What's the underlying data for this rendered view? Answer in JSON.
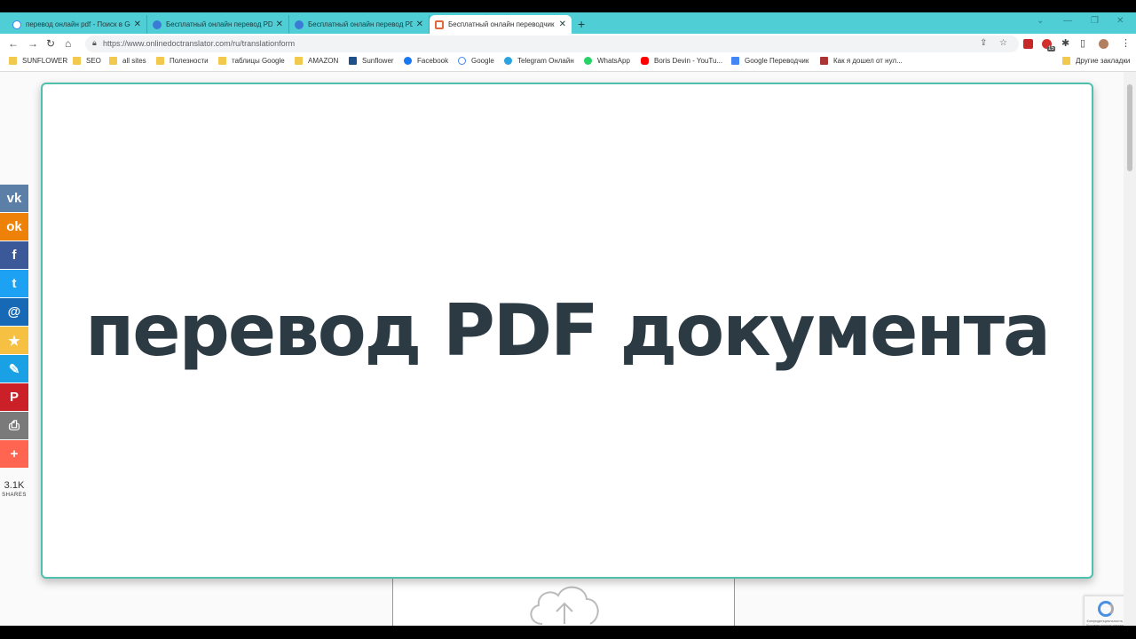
{
  "tabs": [
    {
      "title": "перевод онлайн pdf - Поиск в Google",
      "favicon": "google-icon",
      "active": false
    },
    {
      "title": "Бесплатный онлайн перевод PDF",
      "favicon": "translator-icon",
      "active": false
    },
    {
      "title": "Бесплатный онлайн перевод PDF",
      "favicon": "translator-icon",
      "active": false
    },
    {
      "title": "Бесплатный онлайн переводчик",
      "favicon": "onlinedoctranslator-icon",
      "active": true
    }
  ],
  "new_tab_label": "+",
  "address": {
    "url": "https://www.onlinedoctranslator.com/ru/translationform"
  },
  "bookmarks": [
    {
      "label": "SUNFLOWER",
      "icon": "folder-icon"
    },
    {
      "label": "SEO",
      "icon": "folder-icon"
    },
    {
      "label": "all sites",
      "icon": "folder-icon"
    },
    {
      "label": "Полезности",
      "icon": "folder-icon"
    },
    {
      "label": "таблицы Google",
      "icon": "folder-icon"
    },
    {
      "label": "AMAZON",
      "icon": "folder-icon"
    },
    {
      "label": "Sunflower",
      "icon": "sunflower-icon"
    },
    {
      "label": "Facebook",
      "icon": "facebook-icon"
    },
    {
      "label": "Google",
      "icon": "google-icon"
    },
    {
      "label": "Telegram Онлайн",
      "icon": "telegram-icon"
    },
    {
      "label": "WhatsApp",
      "icon": "whatsapp-icon"
    },
    {
      "label": "Boris Devin - YouTu...",
      "icon": "youtube-icon"
    },
    {
      "label": "Google Переводчик",
      "icon": "google-translate-icon"
    },
    {
      "label": "Как я дошел от нул...",
      "icon": "page-icon"
    }
  ],
  "other_bookmarks": "Другие закладки",
  "share_buttons": [
    {
      "name": "vk",
      "glyph": "vk",
      "color": "#5b7fa6"
    },
    {
      "name": "odnoklassniki",
      "glyph": "ok",
      "color": "#ee8208"
    },
    {
      "name": "facebook",
      "glyph": "f",
      "color": "#3b5998"
    },
    {
      "name": "twitter",
      "glyph": "t",
      "color": "#1da1f2"
    },
    {
      "name": "email",
      "glyph": "@",
      "color": "#1769b5"
    },
    {
      "name": "favorites",
      "glyph": "★",
      "color": "#f6c142"
    },
    {
      "name": "livejournal",
      "glyph": "✎",
      "color": "#19a0e5"
    },
    {
      "name": "pinterest",
      "glyph": "P",
      "color": "#cb2027"
    },
    {
      "name": "print",
      "glyph": "⎙",
      "color": "#7a7a7a"
    },
    {
      "name": "more",
      "glyph": "+",
      "color": "#ff6550"
    }
  ],
  "shares": {
    "count": "3.1K",
    "label": "SHARES"
  },
  "overlay": {
    "title": "перевод PDF документа"
  },
  "recaptcha": {
    "text": "Конфиденциальность - Условия использования"
  },
  "extension_badge": "15"
}
